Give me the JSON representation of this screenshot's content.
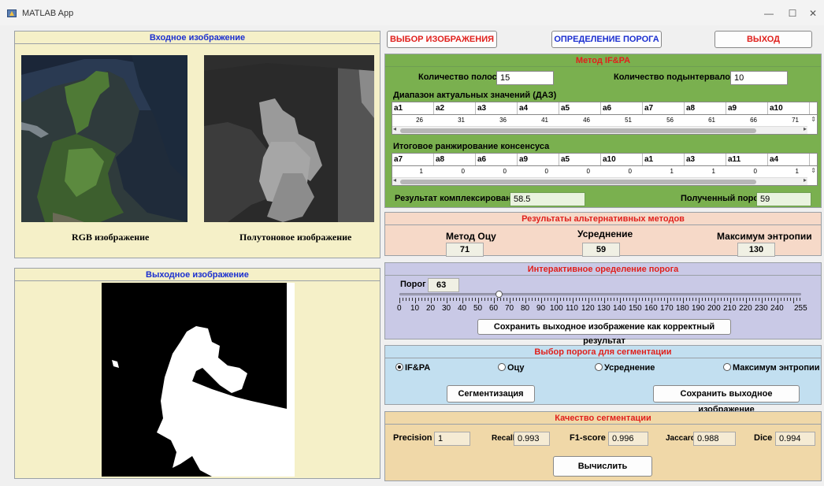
{
  "window": {
    "title": "MATLAB App",
    "minimize": "—",
    "maximize": "☐",
    "close": "✕"
  },
  "input_panel": {
    "title": "Входное изображение",
    "rgb_caption": "RGB изображение",
    "gray_caption": "Полутоновое изображение"
  },
  "output_panel": {
    "title": "Выходное изображение"
  },
  "top_buttons": {
    "select": "ВЫБОР ИЗОБРАЖЕНИЯ",
    "threshold": "ОПРЕДЕЛЕНИЕ ПОРОГА",
    "exit": "ВЫХОД"
  },
  "ifpa": {
    "title": "Метод IF&PA",
    "bands_label": "Количество полос",
    "bands_value": "15",
    "subintervals_label": "Количество подынтервалов",
    "subintervals_value": "10",
    "daz_label": "Диапазон актуальных значений (ДАЗ)",
    "daz_headers": [
      "a1",
      "a2",
      "a3",
      "a4",
      "a5",
      "a6",
      "a7",
      "a8",
      "a9",
      "a10"
    ],
    "daz_values": [
      "26",
      "31",
      "36",
      "41",
      "46",
      "51",
      "56",
      "61",
      "66",
      "71"
    ],
    "rank_label": "Итоговое ранжирование консенсуса",
    "rank_headers": [
      "a7",
      "a8",
      "a6",
      "a9",
      "a5",
      "a10",
      "a1",
      "a3",
      "a11",
      "a4"
    ],
    "rank_values": [
      "1",
      "0",
      "0",
      "0",
      "0",
      "0",
      "1",
      "1",
      "0",
      "1"
    ],
    "complex_label": "Результат комплексирования x* =",
    "complex_value": "58.5",
    "threshold_label": "Полученный порог",
    "threshold_value": "59"
  },
  "alt": {
    "title": "Результаты альтернативных методов",
    "otsu_label": "Метод Оцу",
    "otsu_value": "71",
    "avg_label": "Усреднение",
    "avg_value": "59",
    "entropy_label": "Максимум энтропии",
    "entropy_value": "130"
  },
  "interactive": {
    "title": "Интерактивное оределение порога",
    "threshold_label": "Порог",
    "threshold_value": "63",
    "slider_value": 63,
    "slider_min": 0,
    "slider_max": 255,
    "ticks": [
      "0",
      "10",
      "20",
      "30",
      "40",
      "50",
      "60",
      "70",
      "80",
      "90",
      "100",
      "110",
      "120",
      "130",
      "140",
      "150",
      "160",
      "170",
      "180",
      "190",
      "200",
      "210",
      "220",
      "230",
      "240",
      "255"
    ],
    "save_button": "Сохранить выходное изображение как корректный результат"
  },
  "segsel": {
    "title": "Выбор порога для сегментации",
    "options": [
      "IF&PA",
      "Оцу",
      "Усреднение",
      "Максимум энтропии"
    ],
    "selected": "IF&PA",
    "seg_button": "Сегментизация",
    "save_button": "Сохранить выходное изображение"
  },
  "quality": {
    "title": "Качество сегментации",
    "precision_label": "Precision",
    "precision_value": "1",
    "recall_label": "Recall",
    "recall_value": "0.993",
    "f1_label": "F1-score",
    "f1_value": "0.996",
    "jaccard_label": "Jaccard",
    "jaccard_value": "0.988",
    "dice_label": "Dice",
    "dice_value": "0.994",
    "compute_button": "Вычислить"
  },
  "colors": {
    "yellow_panel": "#f5f0c8",
    "green_panel": "#7ab04f",
    "salmon_panel": "#f6d9c8",
    "lavender_panel": "#c9c9e6",
    "lightblue_panel": "#c2dff0",
    "tan_panel": "#f0d8a8",
    "title_red": "#e0201c",
    "title_blue": "#1b2fd0"
  }
}
